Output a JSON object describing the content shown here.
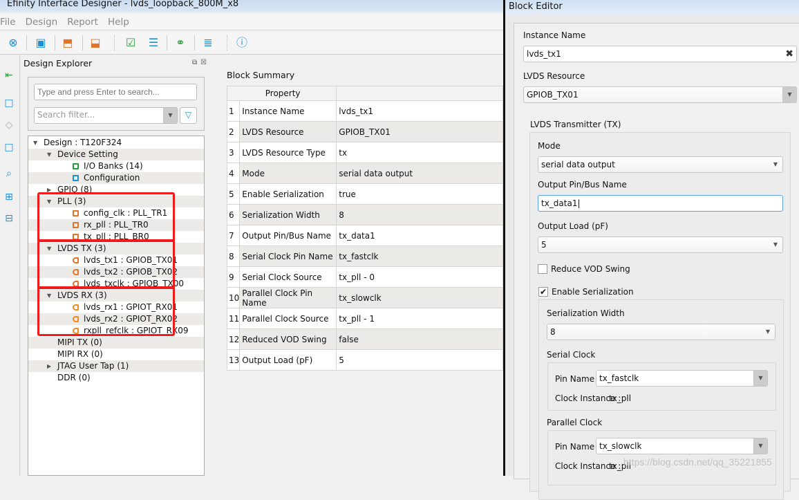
{
  "window": {
    "title": "Efinity Interface Designer - lvds_loopback_800M_x8"
  },
  "menu": [
    "File",
    "Design",
    "Report",
    "Help"
  ],
  "toolbar": {
    "icons": [
      "close-design-icon",
      "save-icon",
      "import-icon",
      "export-icon",
      "check-icon",
      "generate-icon",
      "link-icon",
      "report-icon",
      "help-icon"
    ]
  },
  "explorer": {
    "title": "Design Explorer",
    "search_placeholder": "Type and press Enter to search...",
    "filter_placeholder": "Search filter...",
    "tree": [
      {
        "label": "Design : T120F324",
        "level": 0,
        "arrow": "down"
      },
      {
        "label": "Device Setting",
        "level": 1,
        "arrow": "down"
      },
      {
        "label": "I/O Banks (14)",
        "level": 2,
        "icon": "io-banks-icon"
      },
      {
        "label": "Configuration",
        "level": 2,
        "icon": "configuration-icon"
      },
      {
        "label": "GPIO (8)",
        "level": 1,
        "arrow": "right"
      },
      {
        "label": "PLL (3)",
        "level": 1,
        "arrow": "down"
      },
      {
        "label": "config_clk : PLL_TR1",
        "level": 2,
        "icon": "pll-icon"
      },
      {
        "label": "rx_pll : PLL_TR0",
        "level": 2,
        "icon": "pll-icon"
      },
      {
        "label": "tx_pll : PLL_BR0",
        "level": 2,
        "icon": "pll-icon"
      },
      {
        "label": "LVDS TX (3)",
        "level": 1,
        "arrow": "down"
      },
      {
        "label": "lvds_tx1 : GPIOB_TX01",
        "level": 2,
        "icon": "lvds-tx-icon"
      },
      {
        "label": "lvds_tx2 : GPIOB_TX02",
        "level": 2,
        "icon": "lvds-tx-icon"
      },
      {
        "label": "lvds_txclk : GPIOB_TX00",
        "level": 2,
        "icon": "lvds-tx-icon"
      },
      {
        "label": "LVDS RX (3)",
        "level": 1,
        "arrow": "down"
      },
      {
        "label": "lvds_rx1 : GPIOT_RX01",
        "level": 2,
        "icon": "lvds-rx-icon"
      },
      {
        "label": "lvds_rx2 : GPIOT_RX02",
        "level": 2,
        "icon": "lvds-rx-icon"
      },
      {
        "label": "rxpll_refclk : GPIOT_RX09",
        "level": 2,
        "icon": "lvds-rx-icon"
      },
      {
        "label": "MIPI TX (0)",
        "level": 1
      },
      {
        "label": "MIPI RX (0)",
        "level": 1
      },
      {
        "label": "JTAG User Tap (1)",
        "level": 1,
        "arrow": "right"
      },
      {
        "label": "DDR (0)",
        "level": 1
      }
    ],
    "highlight_color": "#f21b1b"
  },
  "summary": {
    "title": "Block Summary",
    "header": [
      "Property",
      ""
    ],
    "rows": [
      [
        "1",
        "Instance Name",
        "lvds_tx1"
      ],
      [
        "2",
        "LVDS Resource",
        "GPIOB_TX01"
      ],
      [
        "3",
        "LVDS Resource Type",
        "tx"
      ],
      [
        "4",
        "Mode",
        "serial data output"
      ],
      [
        "5",
        "Enable Serialization",
        "true"
      ],
      [
        "6",
        "Serialization Width",
        "8"
      ],
      [
        "7",
        "Output Pin/Bus Name",
        "tx_data1"
      ],
      [
        "8",
        "Serial Clock Pin Name",
        "tx_fastclk"
      ],
      [
        "9",
        "Serial Clock Source",
        "tx_pll - 0"
      ],
      [
        "10",
        "Parallel Clock Pin Name",
        "tx_slowclk"
      ],
      [
        "11",
        "Parallel Clock Source",
        "tx_pll - 1"
      ],
      [
        "12",
        "Reduced VOD Swing",
        "false"
      ],
      [
        "13",
        "Output Load (pF)",
        "5"
      ]
    ]
  },
  "editor": {
    "title": "Block Editor",
    "instance_name_label": "Instance Name",
    "instance_name": "lvds_tx1",
    "resource_label": "LVDS Resource",
    "resource": "GPIOB_TX01",
    "tx_group": "LVDS Transmitter (TX)",
    "mode_label": "Mode",
    "mode": "serial data output",
    "pin_label": "Output Pin/Bus Name",
    "pin": "tx_data1",
    "load_label": "Output Load (pF)",
    "load": "5",
    "reduce_vod_label": "Reduce VOD Swing",
    "reduce_vod": false,
    "enable_ser_label": "Enable Serialization",
    "enable_ser": true,
    "ser_width_label": "Serialization Width",
    "ser_width": "8",
    "serial_clock": {
      "title": "Serial Clock",
      "pin_label": "Pin Name",
      "pin": "tx_fastclk",
      "inst_label": "Clock Instance :",
      "inst": "tx_pll"
    },
    "parallel_clock": {
      "title": "Parallel Clock",
      "pin_label": "Pin Name",
      "pin": "tx_slowclk",
      "inst_label": "Clock Instance :",
      "inst": "tx_pll"
    }
  },
  "watermark": "https://blog.csdn.net/qq_35221855"
}
